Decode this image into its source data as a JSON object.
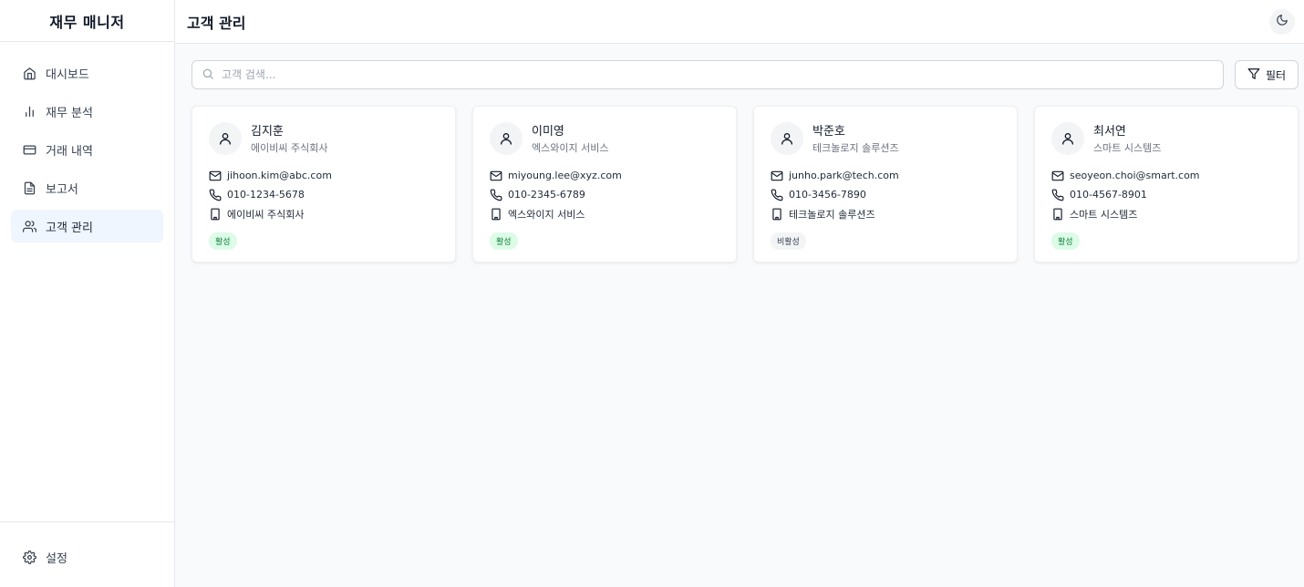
{
  "app": {
    "title": "재무 매니저"
  },
  "sidebar": {
    "items": [
      {
        "label": "대시보드",
        "icon": "home-icon"
      },
      {
        "label": "재무 분석",
        "icon": "bar-chart-icon"
      },
      {
        "label": "거래 내역",
        "icon": "credit-card-icon"
      },
      {
        "label": "보고서",
        "icon": "file-text-icon"
      },
      {
        "label": "고객 관리",
        "icon": "users-icon",
        "active": true
      }
    ],
    "settings_label": "설정"
  },
  "header": {
    "title": "고객 관리",
    "theme_icon": "moon-icon"
  },
  "search": {
    "placeholder": "고객 검색..."
  },
  "filter": {
    "label": "필터"
  },
  "colors": {
    "active_nav_bg": "#eff6ff",
    "active_badge_bg": "#dcfce7",
    "active_badge_fg": "#15803d",
    "inactive_badge_bg": "#f3f4f6"
  },
  "customers": [
    {
      "name": "김지훈",
      "company": "에이비씨 주식회사",
      "email": "jihoon.kim@abc.com",
      "phone": "010-1234-5678",
      "company_info": "에이비씨 주식회사",
      "status": "활성"
    },
    {
      "name": "이미영",
      "company": "엑스와이지 서비스",
      "email": "miyoung.lee@xyz.com",
      "phone": "010-2345-6789",
      "company_info": "엑스와이지 서비스",
      "status": "활성"
    },
    {
      "name": "박준호",
      "company": "테크놀로지 솔루션즈",
      "email": "junho.park@tech.com",
      "phone": "010-3456-7890",
      "company_info": "테크놀로지 솔루션즈",
      "status": "비활성"
    },
    {
      "name": "최서연",
      "company": "스마트 시스템즈",
      "email": "seoyeon.choi@smart.com",
      "phone": "010-4567-8901",
      "company_info": "스마트 시스템즈",
      "status": "활성"
    }
  ]
}
